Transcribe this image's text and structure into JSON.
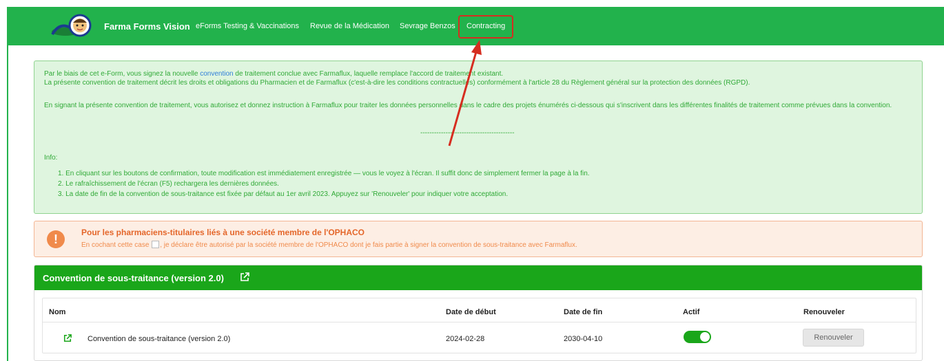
{
  "nav": {
    "brand": "Farma Forms Vision",
    "items": [
      {
        "label": "eForms Testing & Vaccinations"
      },
      {
        "label": "Revue de la Médication"
      },
      {
        "label": "Sevrage Benzos"
      },
      {
        "label": "Contracting"
      }
    ]
  },
  "info": {
    "p1_before_link": "Par le biais de cet e-Form, vous signez la nouvelle ",
    "p1_link": "convention",
    "p1_after_link": " de traitement conclue avec Farmaflux, laquelle remplace l'accord de traitement existant.",
    "p1_line2": "La présente convention de traitement décrit les droits et obligations du Pharmacien et de Farmaflux (c'est-à-dire les conditions contractuelles) conformément à l'article 28 du Règlement général sur la protection des données (RGPD).",
    "p2": "En signant la présente convention de traitement, vous autorisez et donnez instruction à Farmaflux pour traiter les données personnelles dans le cadre des projets énumérés ci-dessous qui s'inscrivent dans les différentes finalités de traitement comme prévues dans la convention.",
    "separator": "-----------------------------------------",
    "info_label": "Info:",
    "list": [
      "1. En cliquant sur les boutons de confirmation, toute modification est immédiatement enregistrée —  vous le voyez à l'écran. Il suffit donc de simplement fermer la page à la fin.",
      "2. Le rafraîchissement de l'écran (F5) rechargera les dernières données.",
      "3. La date de fin de la convention de sous-traitance est fixée par défaut au 1er avril 2023.  Appuyez sur 'Renouveler' pour indiquer votre acceptation."
    ]
  },
  "warning": {
    "icon": "exclamation-icon",
    "title": "Pour les pharmaciens-titulaires liés à une société membre de l'OPHACO",
    "text_before": "En cochant cette case",
    "text_after": ", je déclare être autorisé par la société membre de l'OPHACO dont je fais partie à signer la convention de sous-traitance avec Farmaflux.",
    "checked": false
  },
  "convention": {
    "header_title": "Convention de sous-traitance (version 2.0)",
    "columns": {
      "name": "Nom",
      "start": "Date de début",
      "end": "Date de fin",
      "active": "Actif",
      "renew": "Renouveler"
    },
    "rows": [
      {
        "name": "Convention de sous-traitance (version 2.0)",
        "start": "2024-02-28",
        "end": "2030-04-10",
        "active": true,
        "renew_label": "Renouveler"
      }
    ]
  },
  "colors": {
    "nav_green": "#22b24c",
    "header_green": "#1aa61a",
    "info_text": "#2fa936",
    "warn_orange": "#f08a4b",
    "highlight_red": "#d62d20"
  }
}
